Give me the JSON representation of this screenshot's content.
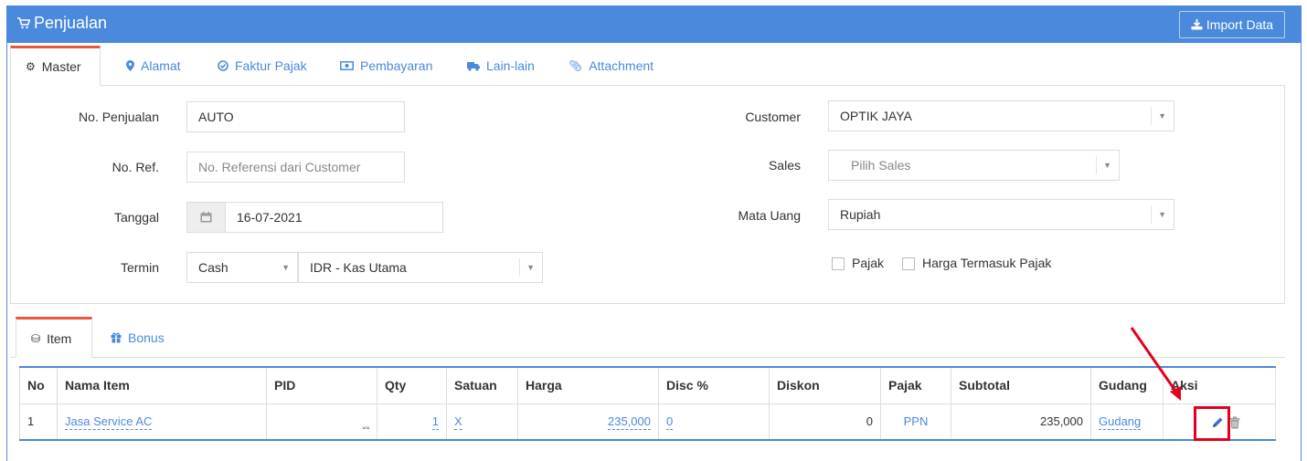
{
  "header": {
    "title": "Penjualan",
    "import_label": "Import Data"
  },
  "tabs": [
    {
      "label": "Master",
      "icon": "gears-icon"
    },
    {
      "label": "Alamat",
      "icon": "map-marker-icon"
    },
    {
      "label": "Faktur Pajak",
      "icon": "check-circle-icon"
    },
    {
      "label": "Pembayaran",
      "icon": "money-icon"
    },
    {
      "label": "Lain-lain",
      "icon": "truck-icon"
    },
    {
      "label": "Attachment",
      "icon": "paperclip-icon"
    }
  ],
  "form": {
    "no_penjualan": {
      "label": "No. Penjualan",
      "value": "AUTO"
    },
    "no_ref": {
      "label": "No. Ref.",
      "placeholder": "No. Referensi dari Customer"
    },
    "tanggal": {
      "label": "Tanggal",
      "value": "16-07-2021"
    },
    "termin": {
      "label": "Termin",
      "value": "Cash",
      "account": "IDR - Kas Utama"
    },
    "customer": {
      "label": "Customer",
      "value": "OPTIK JAYA"
    },
    "sales": {
      "label": "Sales",
      "placeholder": "Pilih Sales"
    },
    "mata_uang": {
      "label": "Mata Uang",
      "value": "Rupiah"
    },
    "pajak": {
      "label": "Pajak"
    },
    "harga_termasuk_pajak": {
      "label": "Harga Termasuk Pajak"
    }
  },
  "item_tabs": [
    {
      "label": "Item",
      "icon": "cubes-icon"
    },
    {
      "label": "Bonus",
      "icon": "gift-icon"
    }
  ],
  "table": {
    "columns": [
      "No",
      "Nama Item",
      "PID",
      "Qty",
      "Satuan",
      "Harga",
      "Disc %",
      "Diskon",
      "Pajak",
      "Subtotal",
      "Gudang",
      "Aksi"
    ],
    "rows": [
      {
        "no": "1",
        "nama_item": "Jasa Service AC",
        "pid": "_",
        "qty": "1",
        "satuan": "X",
        "harga": "235,000",
        "disc_pct": "0",
        "diskon": "0",
        "pajak": "PPN",
        "subtotal": "235,000",
        "gudang": "Gudang"
      }
    ]
  },
  "colors": {
    "primary": "#4a89dc",
    "active_tab_border": "#e9573f",
    "highlight": "#e3001b"
  }
}
